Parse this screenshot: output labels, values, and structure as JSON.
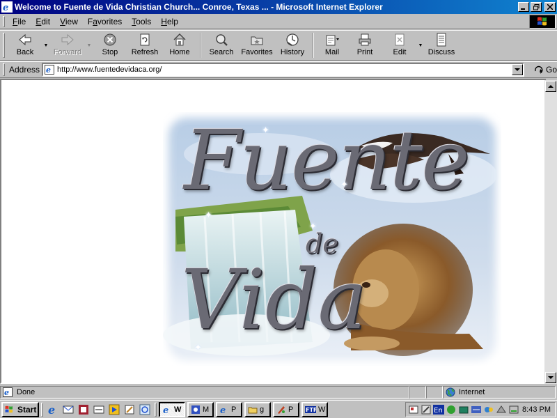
{
  "window": {
    "title": "Welcome to Fuente de Vida Christian Church... Conroe, Texas ... - Microsoft Internet Explorer"
  },
  "menu": [
    {
      "label": "File",
      "ul": "F",
      "rest": "ile"
    },
    {
      "label": "Edit",
      "ul": "E",
      "rest": "dit"
    },
    {
      "label": "View",
      "ul": "V",
      "rest": "iew"
    },
    {
      "label": "Favorites",
      "ul": "a",
      "pre": "F",
      "rest": "vorites"
    },
    {
      "label": "Tools",
      "ul": "T",
      "rest": "ools"
    },
    {
      "label": "Help",
      "ul": "H",
      "rest": "elp"
    }
  ],
  "toolbar": {
    "back": "Back",
    "forward": "Forward",
    "stop": "Stop",
    "refresh": "Refresh",
    "home": "Home",
    "search": "Search",
    "favorites": "Favorites",
    "history": "History",
    "mail": "Mail",
    "print": "Print",
    "edit": "Edit",
    "discuss": "Discuss"
  },
  "address": {
    "label": "Address",
    "url": "http://www.fuentedevidaca.org/",
    "go": "Go"
  },
  "content": {
    "banner": {
      "line1": "Fuente",
      "line2": "de",
      "line3": "Vida"
    }
  },
  "status": {
    "text": "Done",
    "zone": "Internet"
  },
  "taskbar": {
    "start": "Start",
    "tasks": [
      "W",
      "M",
      "P",
      "g",
      "P",
      "W"
    ],
    "clock": "8:43 PM"
  }
}
